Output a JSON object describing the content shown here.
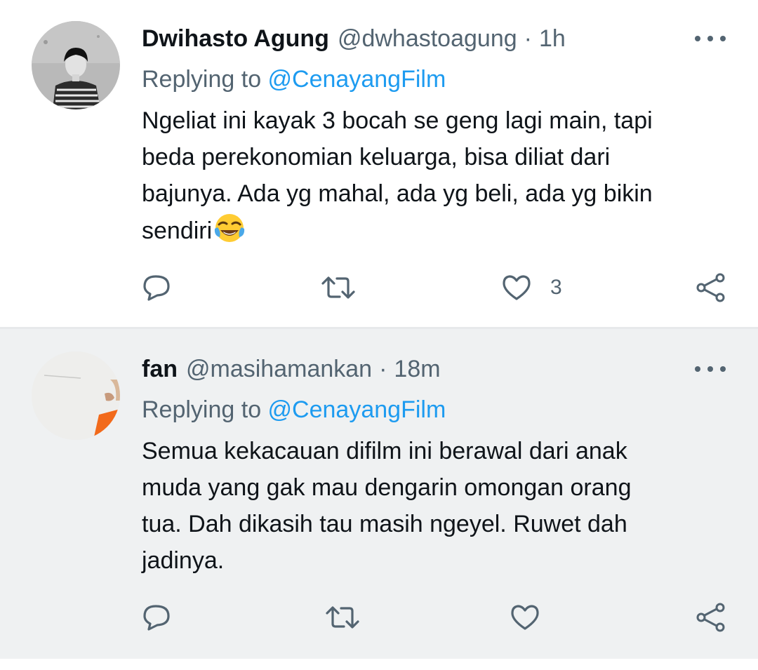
{
  "tweets": [
    {
      "name": "Dwihasto Agung",
      "handle": "@dwhastoagung",
      "separator": "·",
      "time": "1h",
      "replying_prefix": "Replying to ",
      "replying_to": "@CenayangFilm",
      "body_lines": [
        "Ngeliat ini kayak 3 bocah se geng lagi main, tapi",
        "beda perekonomian keluarga, bisa diliat dari",
        "bajunya. Ada yg mahal, ada yg beli, ada yg bikin",
        "sendiri"
      ],
      "body_emoji": "face-with-tears-of-joy",
      "like_count": "3",
      "icons": [
        "reply-icon",
        "retweet-icon",
        "heart-icon",
        "share-icon",
        "more-icon"
      ]
    },
    {
      "name": "fan",
      "handle": "@masihamankan",
      "separator": "·",
      "time": "18m",
      "replying_prefix": "Replying to ",
      "replying_to": "@CenayangFilm",
      "body_lines": [
        "Semua kekacauan difilm ini berawal dari anak",
        "muda yang gak mau dengarin omongan orang",
        "tua. Dah dikasih tau masih ngeyel. Ruwet dah",
        "jadinya."
      ],
      "like_count": "",
      "icons": [
        "reply-icon",
        "retweet-icon",
        "heart-icon",
        "share-icon",
        "more-icon"
      ]
    }
  ],
  "colors": {
    "text": "#0f1419",
    "secondary": "#536471",
    "link": "#1d9bf0",
    "highlight_bg": "#eff1f2",
    "divider": "#e7e9eb"
  }
}
